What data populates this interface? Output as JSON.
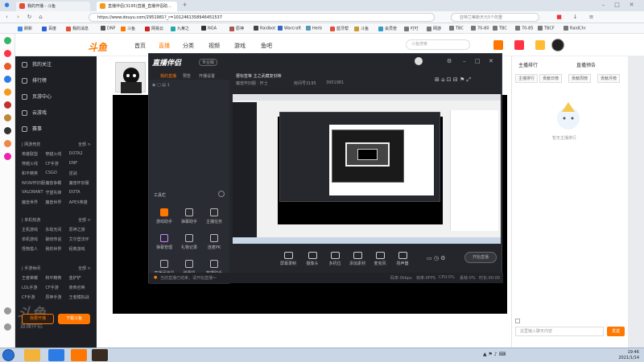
{
  "browser": {
    "tabs": [
      {
        "label": "我的开播 - 斗鱼",
        "color": "#e34d3a"
      },
      {
        "label": "直播伴侣(3195)直播_直播伴侣助...",
        "color": "#f39a1b"
      }
    ],
    "url": "https://www.douyu.com/2951981?_r=1012461358946451537",
    "search_placeholder": "亚特兰蒂斯天元5个的重",
    "bookmarks": [
      "刷新",
      "百度",
      "我的消息",
      "DNF",
      "斗鱼",
      "网易云",
      "九莱之",
      "NGA",
      "原神",
      "Raidbot",
      "Warcraft",
      "Herb",
      "蓝牙帮",
      "斗鱼",
      "会员管",
      "叮叮",
      "网游",
      "TBC",
      "70-80",
      "TBC",
      "70-85",
      "TBCF",
      "RaidChr"
    ]
  },
  "site": {
    "logo": "斗鱼",
    "nav": [
      "首页",
      "直播",
      "分类",
      "视频",
      "游戏",
      "鱼吧"
    ],
    "search_placeholder": "斗鱼搜索"
  },
  "menu": {
    "items": [
      "我的关注",
      "排行榜",
      "页游中心",
      "云游戏",
      "赛事"
    ],
    "sections": [
      {
        "title": "| 网游竞技",
        "more": "全部 >",
        "games": [
          "英雄联盟",
          "穿越火线",
          "DOTA2",
          "穿越火线",
          "CF手游",
          "DNF",
          "和平精英",
          "CSGO",
          "逆战",
          "WOW怀旧服",
          "魔兽争霸",
          "魔兽怀旧服",
          "VALORANT",
          "守望先锋",
          "DOTA",
          "魔兽世界",
          "魔兽世界",
          "APEX英雄"
        ]
      },
      {
        "title": "| 单机热游",
        "more": "全部 >",
        "games": [
          "主机游戏",
          "永劫无间",
          "原神之旅",
          "单机游戏",
          "破晓传说",
          "艾尔登法环",
          "怪物猎人",
          "我的世界",
          "经典游戏"
        ]
      },
      {
        "title": "| 手游休闲",
        "more": "全部 >",
        "games": [
          "王者荣耀",
          "和平精英",
          "金铲铲",
          "LOL手游",
          "CF手游",
          "使命召唤",
          "CF手游",
          "原神手游",
          "王者模拟战"
        ]
      }
    ],
    "footer": {
      "live_btn": "我要开播",
      "download_btn": "下载斗鱼",
      "brand": "斗鱼",
      "sub": "直播伴侣"
    }
  },
  "app": {
    "title": "直播伴侣",
    "badge": "专业版",
    "tabs": [
      "我的直播",
      "预告",
      "开播设置"
    ],
    "room_title": "梗标签等 主之武藏复刻等",
    "room_meta": [
      "魔兽怀旧服 · 怀士",
      "房间号3195",
      "3951981"
    ],
    "tools_title": "工具栏",
    "tools": [
      "游戏助手",
      "弹幕助手",
      "主播任务",
      "弹幕管理",
      "礼物记录",
      "连麦PK",
      "直播间道具",
      "弹幕机",
      "数据助手",
      "房间管理"
    ],
    "controls": [
      "屏幕录制",
      "摄像头",
      "多机位",
      "添加素材",
      "麦克风",
      "扬声器"
    ],
    "start_btn": "开始直播",
    "status": [
      "当前直播已结束，请开始直播～",
      "码率:0kbps",
      "帧率:0FPS",
      "CPU:0%",
      "丢帧:0%",
      "时长:00:00"
    ]
  },
  "chat": {
    "tabs": [
      "主播排行",
      "贡献日榜",
      "贡献周榜",
      "贡献月榜",
      "贵宾榜"
    ],
    "rank_title": "主播排行",
    "announce_title": "直播预告",
    "empty_text": "暂无主播排行",
    "input_placeholder": "这里输入聊天内容",
    "send": "发送"
  },
  "taskbar": {
    "time": "19:46",
    "date": "2021/1/14"
  }
}
